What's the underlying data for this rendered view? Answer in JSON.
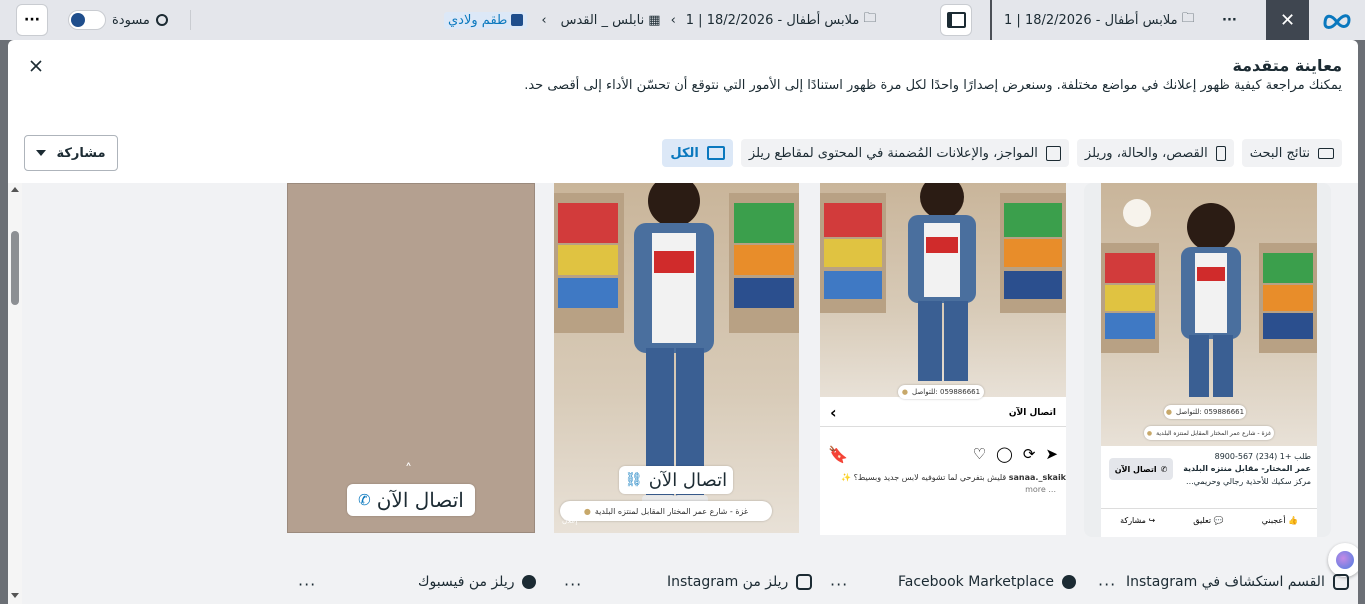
{
  "topbar": {
    "more": "···",
    "draft_label": "مسودة",
    "breadcrumb": {
      "account": "طقم ولادي",
      "campaign": "نابلس _ القدس",
      "adset": "ملابس أطفال - 18/2/2026 | 1",
      "ad": "ملابس أطفال - 18/2/2026 | 1"
    }
  },
  "modal": {
    "title": "معاينة متقدمة",
    "subtitle": "يمكنك مراجعة كيفية ظهور إعلانك في مواضع مختلفة. وسنعرض إصدارًا واحدًا لكل مرة ظهور استنادًا إلى الأمور التي نتوقع أن تحسّن الأداء إلى أقصى حد.",
    "share_label": "مشاركة",
    "tabs": [
      {
        "label": "الكل",
        "active": true
      },
      {
        "label": "المواجز، والإعلانات المُضمنة في المحتوى لمقاطع ريلز",
        "active": false
      },
      {
        "label": "القصص، والحالة، وريلز",
        "active": false
      },
      {
        "label": "نتائج البحث",
        "active": false
      }
    ]
  },
  "cards": {
    "explore": {
      "phone": "059886661 :للتواصل",
      "address": "غزة - شارع عمر المختار المقابل لمنتزه البلدية",
      "call_btn": "اتصال الآن",
      "phone_line": "طلب +1 (234) 567-8900",
      "page_name": "عمر المختار- مقابل منتزه البلدية",
      "desc": "مركز سكيك للأحذية رجالي وحريمي...",
      "like": "أعجبني",
      "comment": "تعليق",
      "share": "مشاركة"
    },
    "marketplace": {
      "phone": "059886661 :للتواصل",
      "cta": "اتصال الآن",
      "username": "sanaa._skaik",
      "caption": "قليش بتفرحي لما تشوفيه لابس جديد وبسيط؟ ✨",
      "more": "more ..."
    },
    "ig_reels": {
      "cta": "اتصال الآن",
      "address": "غزة - شارع عمر المختار المقابل لمنتزه البلدية",
      "ad_label": "إعلان"
    },
    "fb_reels": {
      "cta": "اتصال الآن"
    }
  },
  "footer": {
    "items": [
      {
        "label": "القسم استكشاف في Instagram",
        "icon": "instagram-icon"
      },
      {
        "label": "Facebook Marketplace",
        "icon": "facebook-icon"
      },
      {
        "label": "ريلز من Instagram",
        "icon": "instagram-icon"
      },
      {
        "label": "ريلز من فيسبوك",
        "icon": "facebook-icon"
      }
    ],
    "more": "···"
  },
  "colors": {
    "accent": "#0a78be",
    "topbar": "#e4e6eb",
    "preview_bg": "#f1f2f4",
    "active_tab": "#dce8f7"
  }
}
